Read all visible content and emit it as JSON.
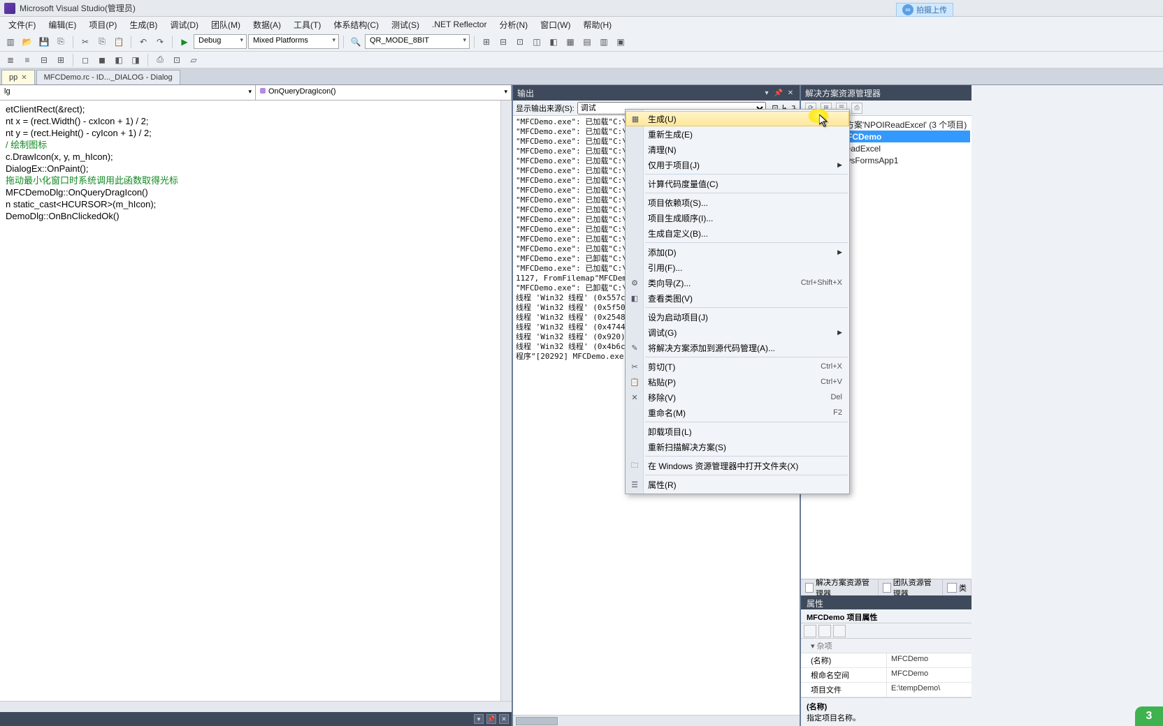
{
  "title": "Microsoft Visual Studio(管理员)",
  "baidu_button": "拍摄上传",
  "menubar": [
    "文件(F)",
    "编辑(E)",
    "项目(P)",
    "生成(B)",
    "调试(D)",
    "团队(M)",
    "数据(A)",
    "工具(T)",
    "体系结构(C)",
    "测试(S)",
    ".NET Reflector",
    "分析(N)",
    "窗口(W)",
    "帮助(H)"
  ],
  "toolbar": {
    "config": "Debug",
    "platform": "Mixed Platforms",
    "target": "QR_MODE_8BIT"
  },
  "doctabs": [
    {
      "label": "pp",
      "active": true
    },
    {
      "label": "MFCDemo.rc - ID..._DIALOG - Dialog",
      "active": false
    }
  ],
  "editor": {
    "scope_left": "lg",
    "scope_right": "OnQueryDragIcon()",
    "code_lines": [
      "etClientRect(&rect);",
      "nt x = (rect.Width() - cxIcon + 1) / 2;",
      "nt y = (rect.Height() - cyIcon + 1) / 2;",
      "",
      "/ 绘制图标",
      "c.DrawIcon(x, y, m_hIcon);",
      "",
      "",
      "",
      "DialogEx::OnPaint();",
      "",
      "",
      "",
      "拖动最小化窗口时系统调用此函数取得光标",
      "",
      "MFCDemoDlg::OnQueryDragIcon()",
      "",
      "n static_cast<HCURSOR>(m_hIcon);",
      "",
      "",
      "",
      "DemoDlg::OnBnClickedOk()"
    ],
    "comment_lines": [
      4,
      13
    ]
  },
  "output": {
    "pane_title": "输出",
    "source_label": "显示输出来源(S):",
    "source_value": "调试",
    "lines": [
      "\"MFCDemo.exe\": 已加载\"C:\\Windows\\SysWOW64\\iertutil.dll\"，Cannot find or",
      "\"MFCDemo.exe\": 已加载\"C:\\Windows\\SysWOW64\\clbcatq.dll\"，Cannot find or o",
      "\"MFCDemo.exe\": 已加载\"C:\\W",
      "\"MFCDemo.exe\": 已加载\"C:\\W",
      "\"MFCDemo.exe\": 已加载\"C:\\W",
      "\"MFCDemo.exe\": 已加载\"C:\\W",
      "\"MFCDemo.exe\": 已加载\"C:\\W",
      "\"MFCDemo.exe\": 已加载\"C:\\W",
      "\"MFCDemo.exe\": 已加载\"C:\\W",
      "\"MFCDemo.exe\": 已加载\"C:\\W",
      "\"MFCDemo.exe\": 已加载\"C:\\W",
      "\"MFCDemo.exe\": 已加载\"C:\\W",
      "\"MFCDemo.exe\": 已加载\"C:\\W",
      "\"MFCDemo.exe\": 已加载\"C:\\W",
      "\"MFCDemo.exe\": 已卸载\"C:\\W",
      "\"MFCDemo.exe\": 已加载\"C:\\W",
      "1127, FromFilemap\"MFCDemo.ex",
      "\"MFCDemo.exe\": 已卸载\"C:\\",
      "线程 'Win32 线程' (0x557c) 已",
      "线程 'Win32 线程' (0x5f50) 已",
      "线程 'Win32 线程' (0x2548) 已",
      "线程 'Win32 线程' (0x4744) 已",
      "线程 'Win32 线程' (0x920) 已退",
      "线程 'Win32 线程' (0x4b6c) 已",
      "程序\"[20292] MFCDemo.exe: 本"
    ]
  },
  "solution": {
    "pane_title": "解决方案资源管理器",
    "root": "解决方案'NPOIReadExcel' (3 个项目)",
    "projects": [
      {
        "name": "MFCDemo",
        "selected": true
      },
      {
        "name": "ReadExcel",
        "selected": false,
        "partial_prefix": ""
      },
      {
        "name": "owsFormsApp1",
        "selected": false
      }
    ],
    "tabs": [
      "解决方案资源管理器",
      "团队资源管理器",
      "类"
    ]
  },
  "properties": {
    "header": "属性",
    "subheader": "MFCDemo 项目属性",
    "category": "杂项",
    "rows": [
      {
        "k": "(名称)",
        "v": "MFCDemo"
      },
      {
        "k": "根命名空间",
        "v": "MFCDemo"
      },
      {
        "k": "项目文件",
        "v": "E:\\tempDemo\\"
      }
    ],
    "help_key": "(名称)",
    "help_text": "指定项目名称。"
  },
  "contextmenu": [
    {
      "type": "item",
      "label": "生成(U)",
      "icon": "▦",
      "hl": true
    },
    {
      "type": "item",
      "label": "重新生成(E)"
    },
    {
      "type": "item",
      "label": "清理(N)"
    },
    {
      "type": "item",
      "label": "仅用于项目(J)",
      "sub": true
    },
    {
      "type": "sep"
    },
    {
      "type": "item",
      "label": "计算代码度量值(C)"
    },
    {
      "type": "sep"
    },
    {
      "type": "item",
      "label": "项目依赖项(S)..."
    },
    {
      "type": "item",
      "label": "项目生成顺序(I)..."
    },
    {
      "type": "item",
      "label": "生成自定义(B)..."
    },
    {
      "type": "sep"
    },
    {
      "type": "item",
      "label": "添加(D)",
      "sub": true
    },
    {
      "type": "item",
      "label": "引用(F)..."
    },
    {
      "type": "item",
      "label": "类向导(Z)...",
      "icon": "⚙",
      "shortcut": "Ctrl+Shift+X"
    },
    {
      "type": "item",
      "label": "查看类图(V)",
      "icon": "◧"
    },
    {
      "type": "sep"
    },
    {
      "type": "item",
      "label": "设为启动项目(J)"
    },
    {
      "type": "item",
      "label": "调试(G)",
      "sub": true
    },
    {
      "type": "item",
      "label": "将解决方案添加到源代码管理(A)...",
      "icon": "✎"
    },
    {
      "type": "sep"
    },
    {
      "type": "item",
      "label": "剪切(T)",
      "icon": "✂",
      "shortcut": "Ctrl+X"
    },
    {
      "type": "item",
      "label": "粘贴(P)",
      "icon": "📋",
      "shortcut": "Ctrl+V"
    },
    {
      "type": "item",
      "label": "移除(V)",
      "icon": "✕",
      "shortcut": "Del"
    },
    {
      "type": "item",
      "label": "重命名(M)",
      "shortcut": "F2"
    },
    {
      "type": "sep"
    },
    {
      "type": "item",
      "label": "卸载项目(L)"
    },
    {
      "type": "item",
      "label": "重新扫描解决方案(S)"
    },
    {
      "type": "sep"
    },
    {
      "type": "item",
      "label": "在 Windows 资源管理器中打开文件夹(X)",
      "icon": "🗀"
    },
    {
      "type": "sep"
    },
    {
      "type": "item",
      "label": "属性(R)",
      "icon": "☰"
    }
  ]
}
